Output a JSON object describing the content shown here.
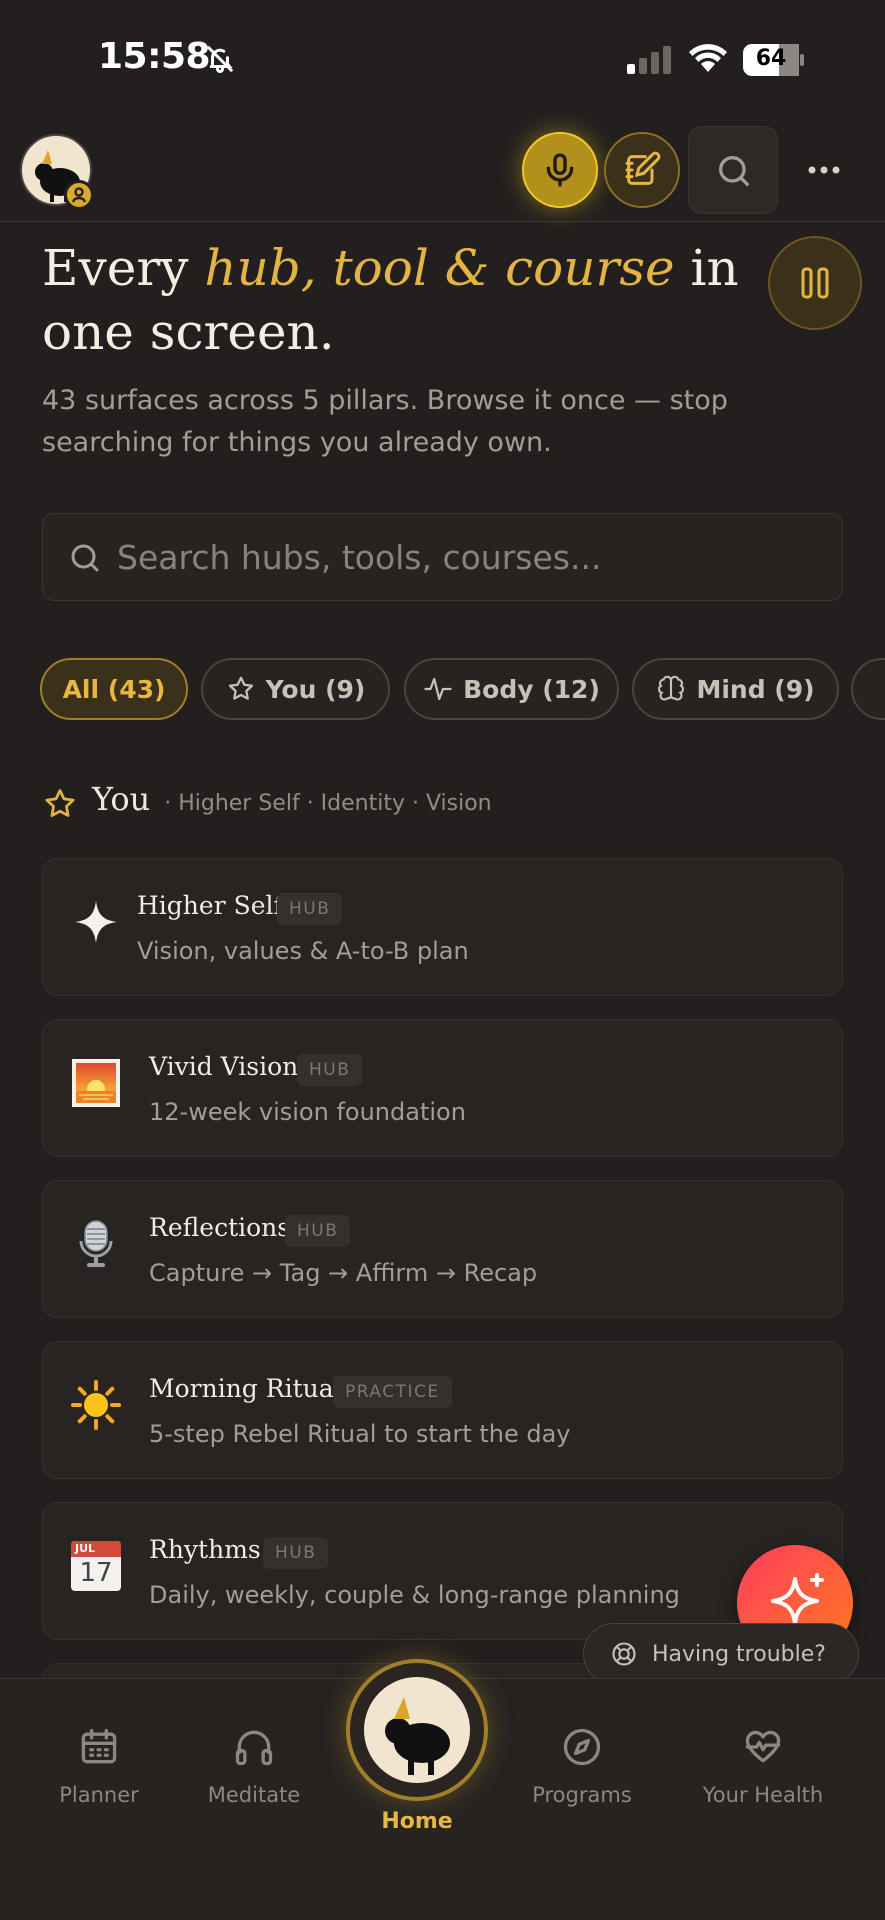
{
  "status_bar": {
    "time": "15:58",
    "battery": "64"
  },
  "header": {
    "accent_color": "#f0c828"
  },
  "hero": {
    "title_pre": "Every ",
    "title_accent": "hub, tool & course",
    "title_post": " in one screen.",
    "subtitle": "43 surfaces across 5 pillars. Browse it once — stop searching for things you already own."
  },
  "search": {
    "placeholder": "Search hubs, tools, courses..."
  },
  "filters": [
    {
      "label": "All (43)",
      "active": true,
      "icon": ""
    },
    {
      "label": "You (9)",
      "active": false,
      "icon": "star-icon"
    },
    {
      "label": "Body (12)",
      "active": false,
      "icon": "pulse-icon"
    },
    {
      "label": "Mind (9)",
      "active": false,
      "icon": "brain-icon"
    }
  ],
  "section": {
    "title": "You",
    "meta": "· Higher Self · Identity · Vision"
  },
  "cards": [
    {
      "name": "Higher Self",
      "tag": "HUB",
      "desc": "Vision, values & A-to-B plan",
      "icon": "sparkle-icon"
    },
    {
      "name": "Vivid Vision",
      "tag": "HUB",
      "desc": "12-week vision foundation",
      "icon": "sunrise-icon"
    },
    {
      "name": "Reflections",
      "tag": "HUB",
      "desc": "Capture → Tag → Affirm → Recap",
      "icon": "microphone-icon"
    },
    {
      "name": "Morning Ritual",
      "tag": "PRACTICE",
      "desc": "5-step Rebel Ritual to start the day",
      "icon": "sun-icon"
    },
    {
      "name": "Rhythms",
      "tag": "HUB",
      "desc": "Daily, weekly, couple & long-range planning",
      "icon": "calendar-icon",
      "calendar_month": "JUL",
      "calendar_day": "17"
    }
  ],
  "help": {
    "label": "Having trouble?"
  },
  "nav": {
    "planner": "Planner",
    "meditate": "Meditate",
    "home": "Home",
    "programs": "Programs",
    "health": "Your Health"
  }
}
